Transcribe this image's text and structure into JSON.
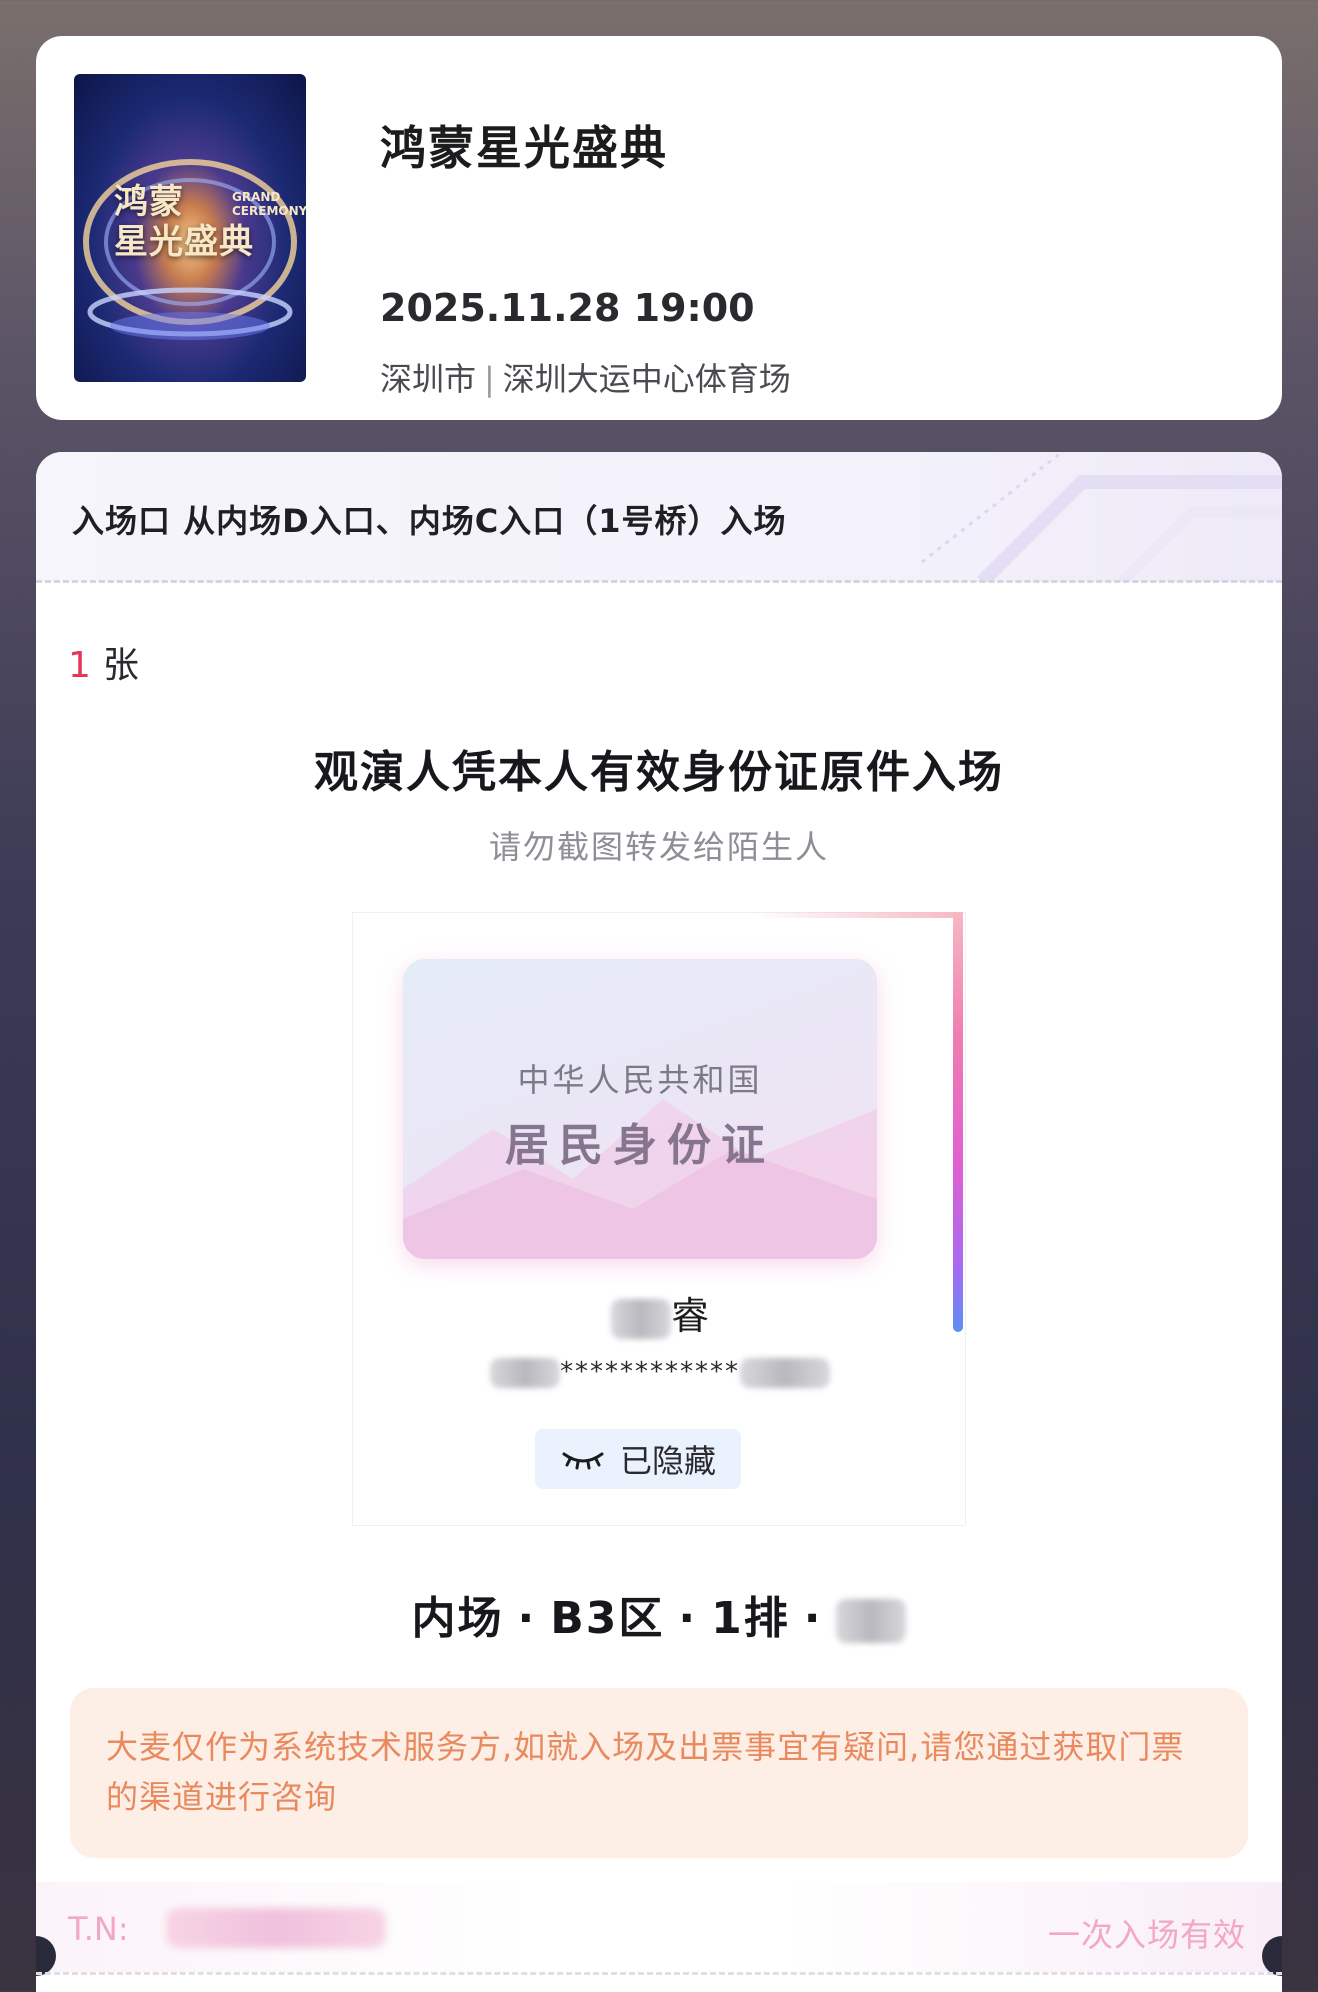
{
  "event": {
    "poster_title": "鸿蒙星光盛典",
    "poster_title_line1": "鸿蒙",
    "poster_title_line2": "星光盛典",
    "poster_subtitle": "GRAND CEREMONY",
    "title": "鸿蒙星光盛典",
    "datetime": "2025.11.28 19:00",
    "city": "深圳市",
    "venue": "深圳大运中心体育场"
  },
  "ticket": {
    "entrance": "入场口 从内场D入口、内场C入口（1号桥）入场",
    "count": "1",
    "count_unit": "张",
    "id_headline": "观演人凭本人有效身份证原件入场",
    "id_subtext": "请勿截图转发给陌生人",
    "id_card": {
      "country": "中华人民共和国",
      "type": "居民身份证"
    },
    "holder_name_visible": "睿",
    "holder_id_masked": "************",
    "hidden_label": "已隐藏",
    "seat": {
      "area": "内场",
      "zone": "B3区",
      "row": "1排",
      "separator": "·"
    },
    "notice": "大麦仅作为系统技术服务方,如就入场及出票事宜有疑问,请您通过获取门票的渠道进行咨询",
    "tn_label": "T.N:",
    "validity": "一次入场有效"
  },
  "colors": {
    "accent_red": "#e2365c",
    "notice_text": "#e98a5e",
    "notice_bg": "#fdeee6",
    "hidden_bg": "#eaf2fd",
    "tn_text": "#f2a7c2"
  },
  "icons": {
    "hidden": "closed-eye-icon"
  }
}
